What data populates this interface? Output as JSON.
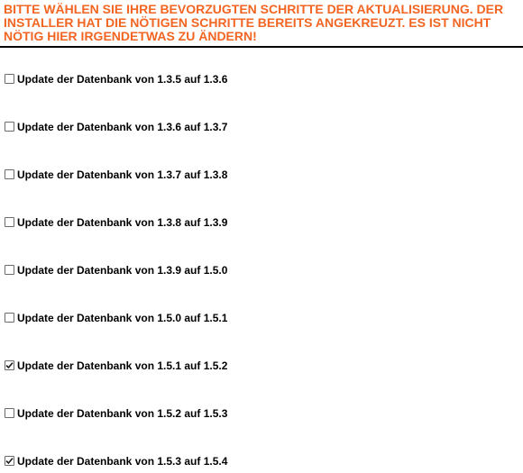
{
  "header": {
    "text": "BITTE WÄHLEN SIE IHRE BEVORZUGTEN SCHRITTE DER AKTUALISIERUNG. DER INSTALLER HAT DIE NÖTIGEN SCHRITTE BEREITS ANGEKREUZT. ES IST NICHT NÖTIG HIER IRGENDETWAS ZU ÄNDERN!",
    "color": "#f26522"
  },
  "steps": [
    {
      "label": "Update der Datenbank von 1.3.5 auf 1.3.6",
      "checked": false
    },
    {
      "label": "Update der Datenbank von 1.3.6 auf 1.3.7",
      "checked": false
    },
    {
      "label": "Update der Datenbank von 1.3.7 auf 1.3.8",
      "checked": false
    },
    {
      "label": "Update der Datenbank von 1.3.8 auf 1.3.9",
      "checked": false
    },
    {
      "label": "Update der Datenbank von 1.3.9 auf 1.5.0",
      "checked": false
    },
    {
      "label": "Update der Datenbank von 1.5.0 auf 1.5.1",
      "checked": false
    },
    {
      "label": "Update der Datenbank von 1.5.1 auf 1.5.2",
      "checked": true
    },
    {
      "label": "Update der Datenbank von 1.5.2 auf 1.5.3",
      "checked": false
    },
    {
      "label": "Update der Datenbank von 1.5.3 auf 1.5.4",
      "checked": true
    }
  ]
}
